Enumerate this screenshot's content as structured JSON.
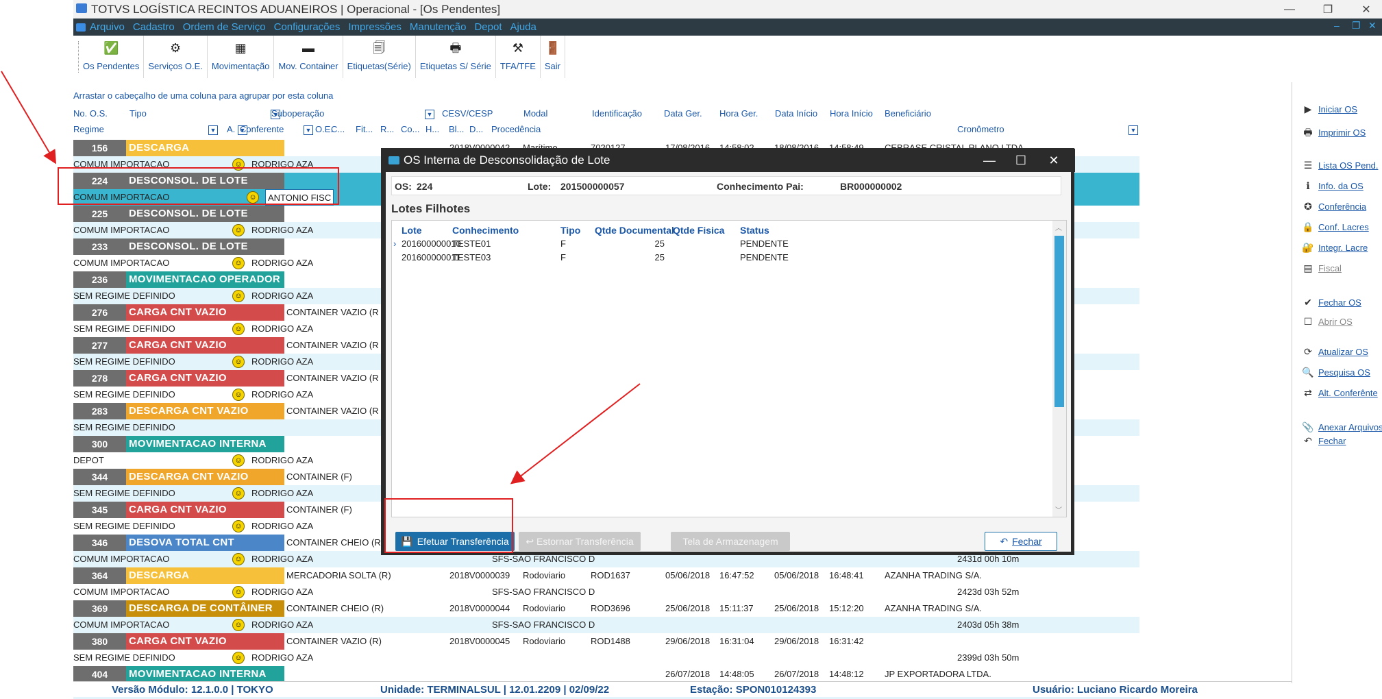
{
  "window": {
    "title": "TOTVS LOGÍSTICA RECINTOS ADUANEIROS | Operacional - [Os Pendentes]",
    "minimize": "—",
    "restore": "❐",
    "close": "✕"
  },
  "menu": [
    "Arquivo",
    "Cadastro",
    "Ordem de Serviço",
    "Configurações",
    "Impressões",
    "Manutenção",
    "Depot",
    "Ajuda"
  ],
  "menu_right": [
    "–",
    "❐",
    "✕"
  ],
  "toolbar": [
    {
      "label": "Os Pendentes",
      "icon": "✅"
    },
    {
      "label": "Serviços O.E.",
      "icon": "⚙"
    },
    {
      "label": "Movimentação",
      "icon": "▦"
    },
    {
      "label": "Mov. Container",
      "icon": "▬"
    },
    {
      "label": "Etiquetas(Série)",
      "icon": "🗐"
    },
    {
      "label": "Etiquetas S/ Série",
      "icon": "🖶"
    },
    {
      "label": "TFA/TFE",
      "icon": "⚒"
    },
    {
      "label": "Sair",
      "icon": "🚪"
    }
  ],
  "grid": {
    "group_hint": "Arrastar o cabeçalho de uma coluna para agrupar por esta coluna",
    "headers1": [
      "No. O.S.",
      "Tipo",
      "Suboperação",
      "CESV/CESP",
      "Modal",
      "Identificação",
      "Data Ger.",
      "Hora Ger.",
      "Data Início",
      "Hora Início",
      "Beneficiário"
    ],
    "headers2": [
      "Regime",
      "A.",
      "Conferente",
      "O.E.",
      "C...",
      "Fit...",
      "R...",
      "Co...",
      "H...",
      "Bl...",
      "D...",
      "Procedência",
      "Cronômetro"
    ],
    "rows": [
      {
        "num": "156",
        "type": "DESCARGA",
        "color": "#f6c03a",
        "regime": "COMUM IMPORTACAO",
        "conferente": "RODRIGO AZA",
        "sub": "",
        "cesv": "2018V0000042",
        "modal": "Marítimo",
        "ident": "7020127",
        "dg": "17/08/2016",
        "hg": "14:58:02",
        "di": "18/08/2016",
        "hi": "14:58:49",
        "benef": "CEBRASE CRISTAL PLANO LTDA",
        "proc": "",
        "crono": ""
      },
      {
        "num": "224",
        "type": "DESCONSOL. DE LOTE",
        "color": "#6e6e6e",
        "regime": "COMUM IMPORTACAO",
        "conferente": "ANTONIO FISC",
        "sub": "",
        "selected": true
      },
      {
        "num": "225",
        "type": "DESCONSOL. DE LOTE",
        "color": "#6e6e6e",
        "regime": "COMUM IMPORTACAO",
        "conferente": "RODRIGO AZA",
        "sub": ""
      },
      {
        "num": "233",
        "type": "DESCONSOL. DE LOTE",
        "color": "#6e6e6e",
        "regime": "COMUM IMPORTACAO",
        "conferente": "RODRIGO AZA",
        "sub": ""
      },
      {
        "num": "236",
        "type": "MOVIMENTACAO OPERADOR",
        "color": "#21a39c",
        "regime": "SEM REGIME DEFINIDO",
        "conferente": "RODRIGO AZA",
        "sub": ""
      },
      {
        "num": "276",
        "type": "CARGA CNT VAZIO",
        "color": "#d34b4b",
        "regime": "SEM REGIME DEFINIDO",
        "conferente": "RODRIGO AZA",
        "sub": "CONTAINER VAZIO (R"
      },
      {
        "num": "277",
        "type": "CARGA CNT VAZIO",
        "color": "#d34b4b",
        "regime": "SEM REGIME DEFINIDO",
        "conferente": "RODRIGO AZA",
        "sub": "CONTAINER VAZIO (R"
      },
      {
        "num": "278",
        "type": "CARGA CNT VAZIO",
        "color": "#d34b4b",
        "regime": "SEM REGIME DEFINIDO",
        "conferente": "RODRIGO AZA",
        "sub": "CONTAINER VAZIO (R"
      },
      {
        "num": "283",
        "type": "DESCARGA CNT VAZIO",
        "color": "#f0a62a",
        "regime": "SEM REGIME DEFINIDO",
        "conferente": "",
        "sub": "CONTAINER VAZIO (R"
      },
      {
        "num": "300",
        "type": "MOVIMENTACAO INTERNA",
        "color": "#21a39c",
        "regime": "DEPOT",
        "conferente": "RODRIGO AZA",
        "sub": ""
      },
      {
        "num": "344",
        "type": "DESCARGA CNT VAZIO",
        "color": "#f0a62a",
        "regime": "SEM REGIME DEFINIDO",
        "conferente": "RODRIGO AZA",
        "sub": "CONTAINER (F)"
      },
      {
        "num": "345",
        "type": "CARGA CNT VAZIO",
        "color": "#d34b4b",
        "regime": "SEM REGIME DEFINIDO",
        "conferente": "RODRIGO AZA",
        "sub": "CONTAINER (F)"
      },
      {
        "num": "346",
        "type": "DESOVA TOTAL CNT",
        "color": "#4a86c8",
        "regime": "COMUM IMPORTACAO",
        "conferente": "RODRIGO AZA",
        "sub": "CONTAINER CHEIO (R",
        "proc": "SFS-SAO FRANCISCO D",
        "crono": "2431d 00h 10m"
      },
      {
        "num": "364",
        "type": "DESCARGA",
        "color": "#f6c03a",
        "regime": "COMUM IMPORTACAO",
        "conferente": "RODRIGO AZA",
        "sub": "MERCADORIA SOLTA (R)",
        "cesv": "2018V0000039",
        "modal": "Rodoviario",
        "ident": "ROD1637",
        "dg": "05/06/2018",
        "hg": "16:47:52",
        "di": "05/06/2018",
        "hi": "16:48:41",
        "benef": "AZANHA TRADING S/A.",
        "proc": "SFS-SAO FRANCISCO D",
        "crono": "2423d 03h 52m"
      },
      {
        "num": "369",
        "type": "DESCARGA DE CONTÂINER",
        "color": "#c8900a",
        "regime": "COMUM IMPORTACAO",
        "conferente": "RODRIGO AZA",
        "sub": "CONTAINER CHEIO (R)",
        "cesv": "2018V0000044",
        "modal": "Rodoviario",
        "ident": "ROD3696",
        "dg": "25/06/2018",
        "hg": "15:11:37",
        "di": "25/06/2018",
        "hi": "15:12:20",
        "benef": "AZANHA TRADING S/A.",
        "proc": "SFS-SAO FRANCISCO D",
        "crono": "2403d 05h 38m"
      },
      {
        "num": "380",
        "type": "CARGA CNT VAZIO",
        "color": "#d34b4b",
        "regime": "SEM REGIME DEFINIDO",
        "conferente": "RODRIGO AZA",
        "sub": "CONTAINER VAZIO (R)",
        "cesv": "2018V0000045",
        "modal": "Rodoviario",
        "ident": "ROD1488",
        "dg": "29/06/2018",
        "hg": "16:31:04",
        "di": "29/06/2018",
        "hi": "16:31:42",
        "benef": "",
        "proc": "",
        "crono": "2399d 03h 50m"
      },
      {
        "num": "404",
        "type": "MOVIMENTACAO INTERNA",
        "color": "#21a39c",
        "regime": "",
        "conferente": "",
        "sub": "",
        "dg": "26/07/2018",
        "hg": "14:48:05",
        "di": "26/07/2018",
        "hi": "14:48:12",
        "benef": "JP EXPORTADORA LTDA."
      }
    ]
  },
  "right_panel": [
    {
      "label": "Iniciar OS",
      "icon": "▶",
      "enabled": true
    },
    {
      "label": "Imprimir OS",
      "icon": "🖶",
      "enabled": true
    },
    {
      "label": "Lista OS Pend.",
      "icon": "☰",
      "enabled": true
    },
    {
      "label": "Info. da OS",
      "icon": "ℹ",
      "enabled": true
    },
    {
      "label": "Conferência",
      "icon": "✪",
      "enabled": true
    },
    {
      "label": "Conf. Lacres",
      "icon": "🔒",
      "enabled": true
    },
    {
      "label": "Integr. Lacre",
      "icon": "🔐",
      "enabled": true
    },
    {
      "label": "Fiscal",
      "icon": "▤",
      "enabled": false
    },
    {
      "label": "Fechar OS",
      "icon": "✔",
      "enabled": true
    },
    {
      "label": "Abrir OS",
      "icon": "☐",
      "enabled": false
    },
    {
      "label": "Atualizar OS",
      "icon": "⟳",
      "enabled": true
    },
    {
      "label": "Pesquisa OS",
      "icon": "🔍",
      "enabled": true
    },
    {
      "label": "Alt. Conferênte",
      "icon": "⇄",
      "enabled": true
    },
    {
      "label": "Anexar Arquivos",
      "icon": "📎",
      "enabled": true
    },
    {
      "label": "Fechar",
      "icon": "↶",
      "enabled": true
    }
  ],
  "status": {
    "versao": "Versão Módulo:  12.1.0.0  |  TOKYO",
    "unidade": "Unidade:  TERMINALSUL | 12.01.2209 | 02/09/22",
    "estacao": "Estação:  SPON010124393",
    "usuario": "Usuário:  Luciano Ricardo Moreira"
  },
  "modal": {
    "title": "OS Interna de Desconsolidação de Lote",
    "os_label": "OS:",
    "os_value": "224",
    "lote_label": "Lote:",
    "lote_value": "201500000057",
    "conh_label": "Conhecimento Pai:",
    "conh_value": "BR000000002",
    "subtitle": "Lotes Filhotes",
    "columns": [
      "Lote",
      "Conhecimento",
      "Tipo",
      "Qtde Documental",
      "Qtde Fisica",
      "Status"
    ],
    "rows": [
      {
        "lote": "201600000010",
        "conh": "TESTE01",
        "tipo": "F",
        "qdoc": "25",
        "qfis": "",
        "status": "PENDENTE"
      },
      {
        "lote": "201600000011",
        "conh": "TESTE03",
        "tipo": "F",
        "qdoc": "25",
        "qfis": "",
        "status": "PENDENTE"
      }
    ],
    "btn_efetuar": "Efetuar Transferência",
    "btn_estornar": "Estornar Transferência",
    "btn_tela": "Tela de Armazenagem",
    "btn_fechar": "Fechar"
  }
}
